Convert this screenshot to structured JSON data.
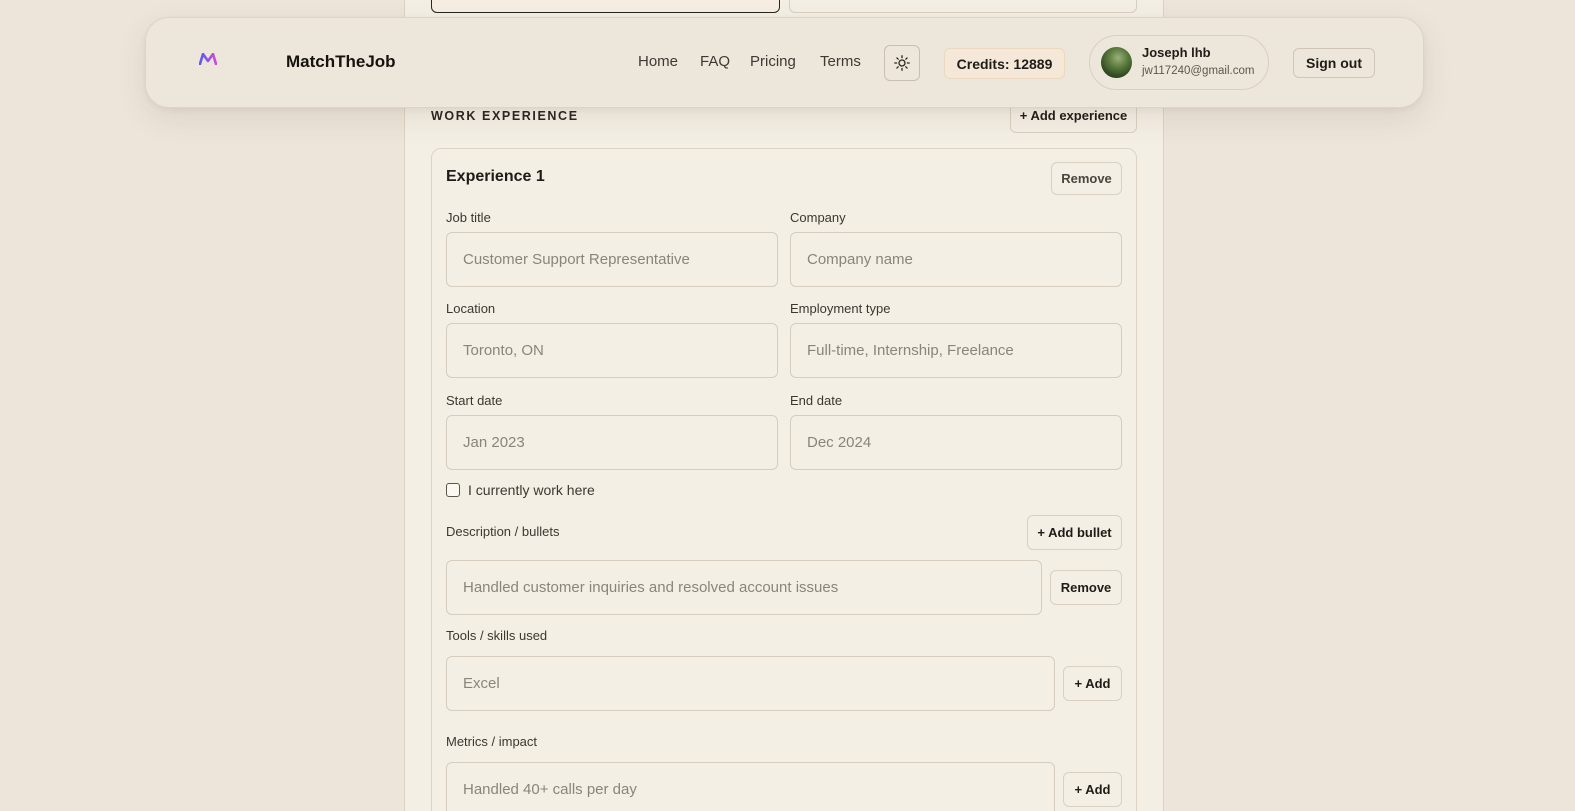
{
  "header": {
    "brand": "MatchTheJob",
    "nav": [
      "Home",
      "FAQ",
      "Pricing",
      "Terms"
    ],
    "credits": "Credits: 12889",
    "user_name": "Joseph lhb",
    "user_email": "jw117240@gmail.com",
    "sign_out": "Sign out",
    "theme_icon": "sun-icon",
    "accent_colors": [
      "#5b5cf0",
      "#d04ad6"
    ]
  },
  "work_experience": {
    "section_title": "WORK EXPERIENCE",
    "add_experience": "+ Add experience",
    "experience": {
      "title": "Experience 1",
      "remove": "Remove",
      "job_title_label": "Job title",
      "job_title_placeholder": "Customer Support Representative",
      "company_label": "Company",
      "company_placeholder": "Company name",
      "location_label": "Location",
      "location_placeholder": "Toronto, ON",
      "employment_type_label": "Employment type",
      "employment_type_placeholder": "Full-time, Internship, Freelance",
      "start_date_label": "Start date",
      "start_date_placeholder": "Jan 2023",
      "end_date_label": "End date",
      "end_date_placeholder": "Dec 2024",
      "current_label": "I currently work here",
      "description_label": "Description / bullets",
      "add_bullet": "+ Add bullet",
      "bullet_placeholder": "Handled customer inquiries and resolved account issues",
      "bullet_remove": "Remove",
      "tools_label": "Tools / skills used",
      "tools_placeholder": "Excel",
      "tools_add": "+ Add",
      "metrics_label": "Metrics / impact",
      "metrics_placeholder": "Handled 40+ calls per day",
      "metrics_add": "+ Add"
    }
  }
}
